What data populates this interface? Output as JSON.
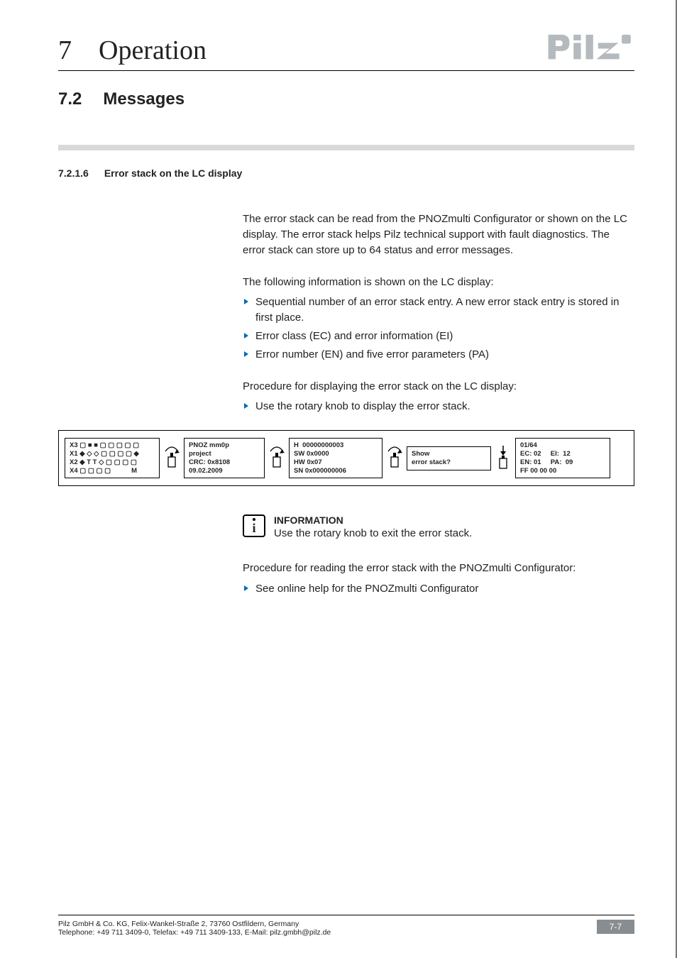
{
  "header": {
    "chapter_number": "7",
    "chapter_title": "Operation"
  },
  "section": {
    "number": "7.2",
    "title": "Messages"
  },
  "subsection": {
    "number": "7.2.1.6",
    "title": "Error stack on the LC display"
  },
  "body": {
    "p1": "The error stack can be read from the PNOZmulti Configurator or shown on the LC display. The error stack helps Pilz technical support with fault diagnostics. The error stack can store up to 64 status and error messages.",
    "p2": "The following information is shown on the LC display:",
    "bullets_a": [
      "Sequential number of an error stack entry. A new error stack entry is stored in first place.",
      "Error class (EC) and error information (EI)",
      "Error number (EN) and five error parameters (PA)"
    ],
    "p3": "Procedure for displaying the error stack on the LC display:",
    "bullets_b": [
      "Use the rotary knob to display the error stack."
    ],
    "p4": "Procedure for reading the error stack with the PNOZmulti Configurator:",
    "bullets_c": [
      "See online help for the PNOZmulti Configurator"
    ]
  },
  "lcd": {
    "box1": "X3 ▢ ■ ■ ▢ ▢ ▢ ▢ ▢\nX1 ◆ ◇ ◇ ▢ ▢ ▢ ▢ ◆\nX2 ◆ T T ◇ ▢ ▢ ▢ ▢\nX4 ▢ ▢ ▢ ▢           M",
    "box2": "PNOZ mm0p\nproject\nCRC: 0x8108\n09.02.2009",
    "box3": "H  00000000003\nSW 0x0000\nHW 0x07\nSN 0x000000006",
    "box4": "Show\nerror stack?",
    "box5": "01/64\nEC: 02     EI:  12\nEN: 01     PA:  09\nFF 00 00 00"
  },
  "info": {
    "title": "INFORMATION",
    "text": "Use the rotary knob to exit the error stack."
  },
  "footer": {
    "line1": "Pilz GmbH & Co. KG, Felix-Wankel-Straße 2, 73760 Ostfildern, Germany",
    "line2": "Telephone: +49 711 3409-0, Telefax: +49 711 3409-133, E-Mail: pilz.gmbh@pilz.de",
    "page": "7-7"
  }
}
